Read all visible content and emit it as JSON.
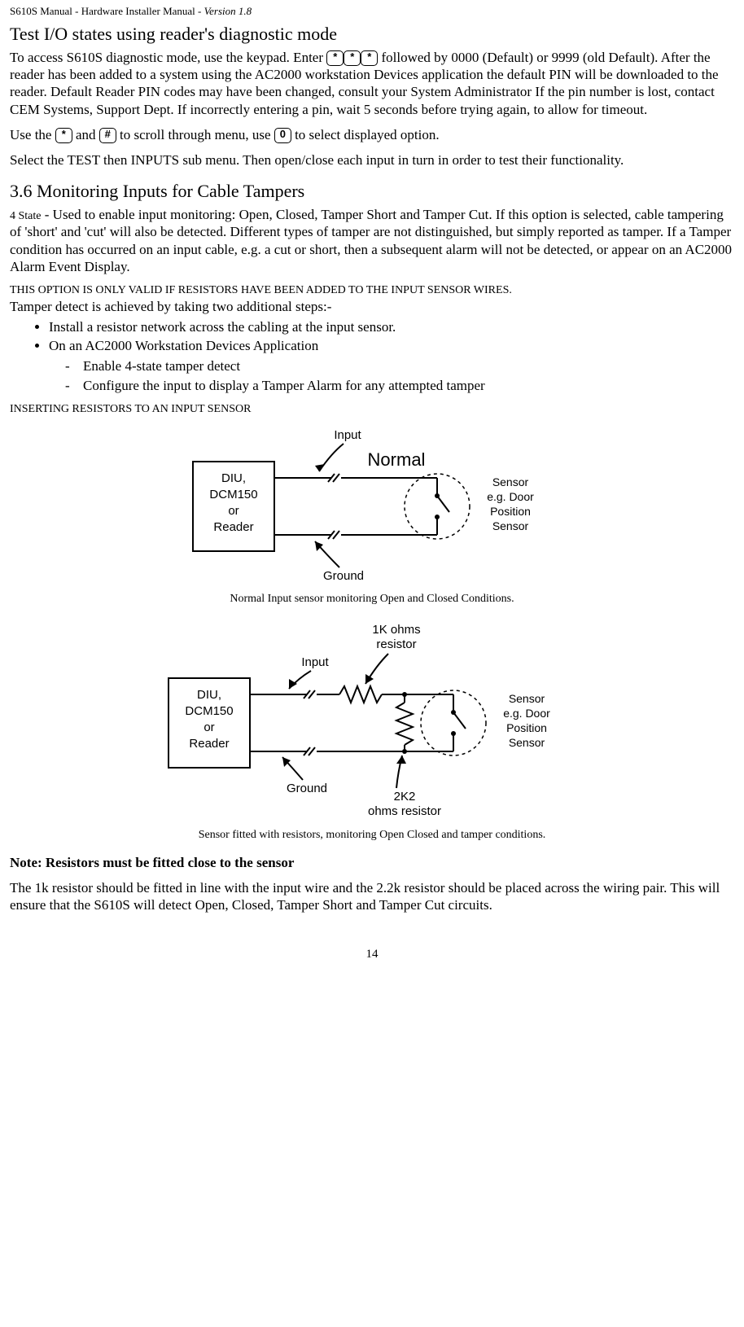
{
  "header": {
    "left": "S610S Manual  - Hardware Installer Manual  - ",
    "version": "Version 1.8"
  },
  "h_test": "Test I/O states using reader's diagnostic mode",
  "p_access_a": "To access S610S diagnostic mode, use the keypad.   Enter ",
  "p_access_b": "  followed by 0000 (Default) or 9999 (old Default).  After the reader has been added to a system using the AC2000 workstation Devices application the default PIN  will be downloaded to the reader.  Default Reader PIN codes may have been changed, consult your System Administrator If the pin number is lost, contact CEM Systems, Support Dept.  If incorrectly entering a pin, wait 5 seconds before trying again, to allow for timeout.",
  "p_use_1": "Use the ",
  "p_use_2": " and ",
  "p_use_3": " to scroll through menu, use ",
  "p_use_4": " to select displayed option.",
  "p_select": "Select the TEST then INPUTS sub menu.  Then open/close each input in turn in order to test their functionality.",
  "h_36": "3.6    Monitoring Inputs for Cable Tampers",
  "sc_4state": "4 State",
  "p_4state": " - Used to enable input monitoring: Open, Closed, Tamper Short and Tamper Cut.  If  this option is selected, cable tampering of 'short' and 'cut' will also be detected.  Different types of tamper are not distinguished, but simply reported as tamper.  If a Tamper condition has occurred on an input cable, e.g. a cut or short, then a subsequent alarm will not be detected, or appear on an AC2000 Alarm Event Display.",
  "p_option_valid": "THIS OPTION IS ONLY VALID IF RESISTORS HAVE BEEN ADDED TO THE INPUT SENSOR WIRES.",
  "p_tamper_steps": "Tamper detect is achieved by taking two additional steps:-",
  "li_1": "Install a resistor network across the cabling at the input sensor.",
  "li_2": "On an AC2000 Workstation Devices Application",
  "li_2a": "Enable 4-state tamper detect",
  "li_2b": "Configure the input to display a Tamper Alarm for any attempted tamper",
  "h_insert": "INSERTING RESISTORS TO AN INPUT SENSOR",
  "cap1": "Normal Input sensor monitoring Open and Closed Conditions.",
  "cap2": "Sensor fitted with resistors, monitoring Open Closed and tamper conditions.",
  "note": "Note: Resistors must be fitted close to the sensor",
  "p_1k": "The 1k resistor should be fitted in line with the input wire and the 2.2k resistor should be placed across the wiring pair.  This will ensure that the S610S will detect Open, Closed, Tamper Short and Tamper Cut circuits.",
  "pagenum": "14",
  "d1": {
    "box1": "DIU,",
    "box2": "DCM150",
    "box3": "or",
    "box4": "Reader",
    "normal": "Normal",
    "input": "Input",
    "ground": "Ground",
    "s1": "Sensor",
    "s2": "e.g. Door",
    "s3": "Position",
    "s4": "Sensor"
  },
  "d2": {
    "box1": "DIU,",
    "box2": "DCM150",
    "box3": "or",
    "box4": "Reader",
    "r1a": "1K ohms",
    "r1b": "resistor",
    "r2a": "2K2",
    "r2b": "ohms resistor",
    "input": "Input",
    "ground": "Ground",
    "s1": "Sensor",
    "s2": "e.g. Door",
    "s3": "Position",
    "s4": "Sensor"
  }
}
